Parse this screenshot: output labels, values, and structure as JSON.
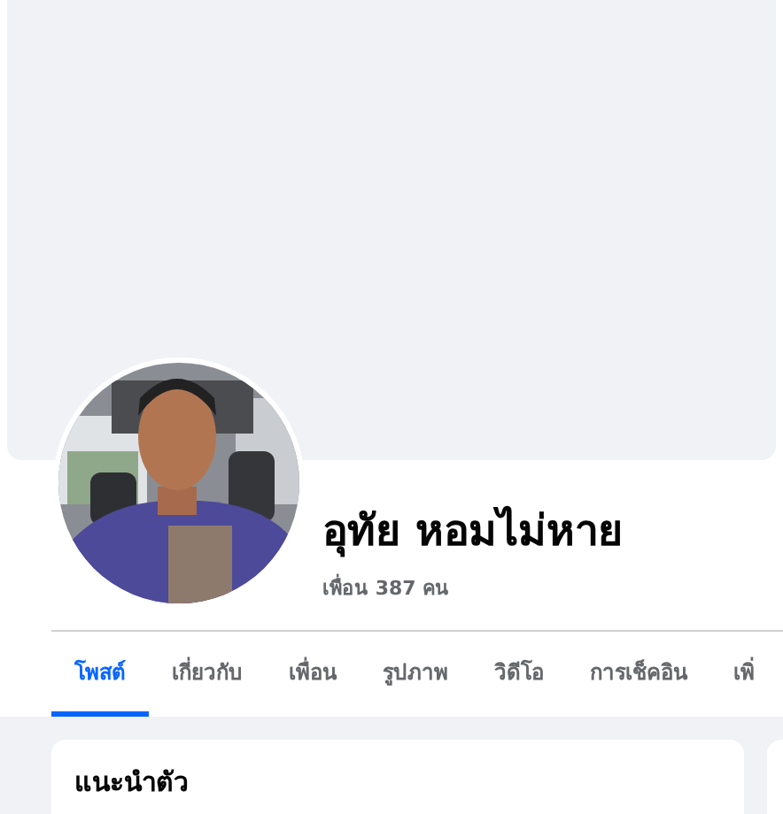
{
  "profile": {
    "name": "อุทัย หอมไม่หาย",
    "friends": "เพื่อน 387 คน"
  },
  "tabs": [
    {
      "label": "โพสต์",
      "selected": true
    },
    {
      "label": "เกี่ยวกับ",
      "selected": false
    },
    {
      "label": "เพื่อน",
      "selected": false
    },
    {
      "label": "รูปภาพ",
      "selected": false
    },
    {
      "label": "วิดีโอ",
      "selected": false
    },
    {
      "label": "การเช็คอิน",
      "selected": false
    },
    {
      "label": "เพิ่",
      "selected": false
    }
  ],
  "intro_card": {
    "title": "แนะนำตัว"
  }
}
